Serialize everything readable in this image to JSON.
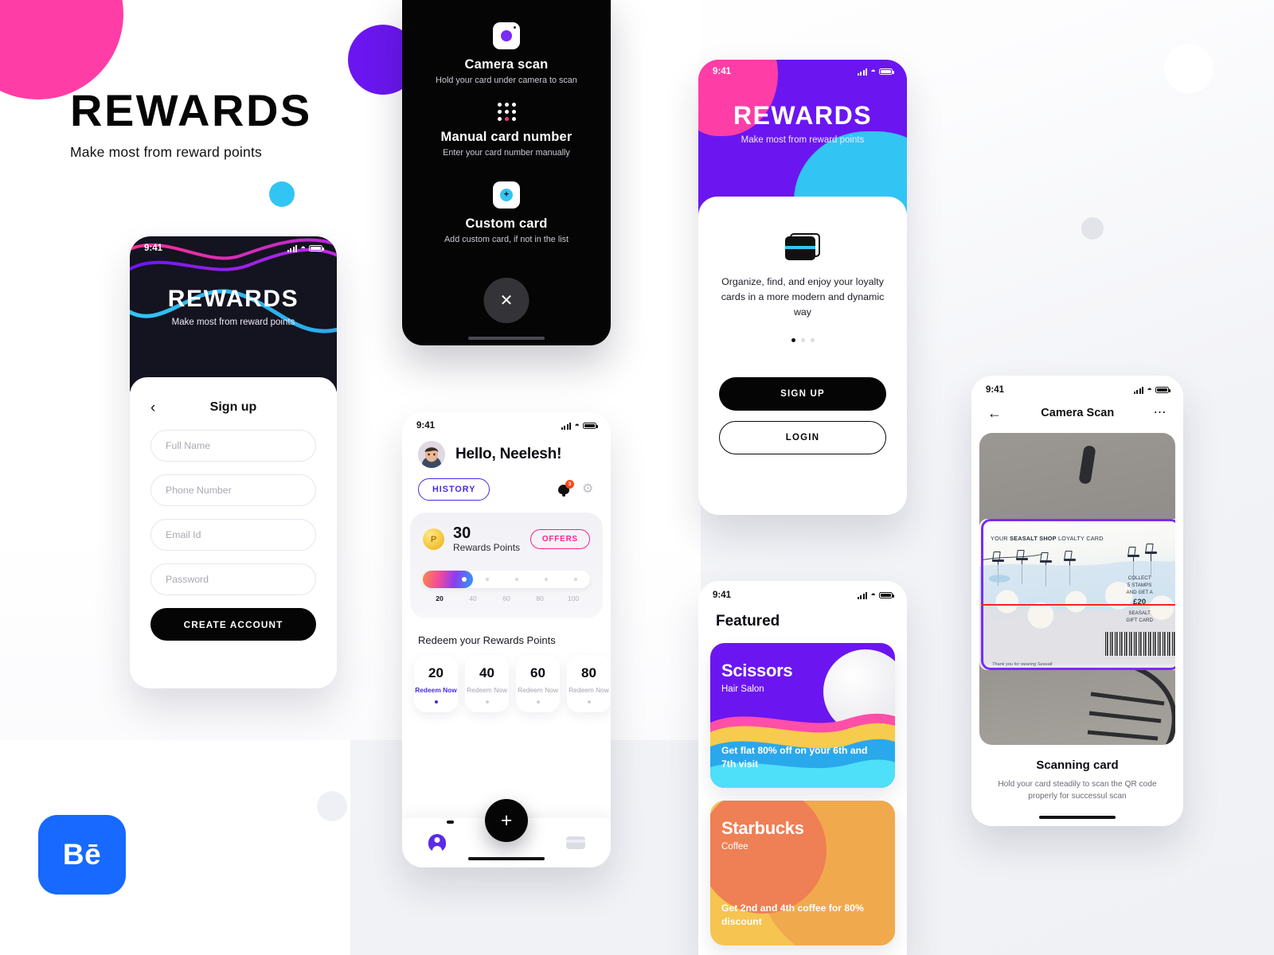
{
  "hero": {
    "title": "REWARDS",
    "subtitle": "Make most from reward points"
  },
  "behance": {
    "mark": "Bē"
  },
  "colors": {
    "background": "#F2F3F7",
    "pink": "#FF3DA6",
    "purple": "#6B16F0",
    "cyan": "#32C5F4",
    "indigo": "#4B2AE0",
    "magenta": "#FF1F8E",
    "black": "#050505",
    "behance_blue": "#1769FF",
    "orange": "#EF7F54",
    "yellow": "#F5C451",
    "laser_red": "#FF2020"
  },
  "status_bar": {
    "time": "9:41"
  },
  "signup_screen": {
    "hero_title": "REWARDS",
    "hero_subtitle": "Make most from reward points",
    "back_icon": "chevron-left-icon",
    "heading": "Sign up",
    "fields": [
      {
        "placeholder": "Full Name"
      },
      {
        "placeholder": "Phone Number"
      },
      {
        "placeholder": "Email Id"
      },
      {
        "placeholder": "Password"
      }
    ],
    "cta": "CREATE ACCOUNT"
  },
  "add_card_sheet": {
    "options": [
      {
        "icon": "camera-icon",
        "title": "Camera scan",
        "desc": "Hold your card under camera to scan"
      },
      {
        "icon": "keypad-icon",
        "title": "Manual card number",
        "desc": "Enter your card number manually"
      },
      {
        "icon": "plus-circle-icon",
        "title": "Custom card",
        "desc": "Add custom card, if not in the list"
      }
    ],
    "close_icon": "close-icon"
  },
  "dashboard": {
    "greeting": "Hello, Neelesh!",
    "avatar_icon": "avatar",
    "history_button": "HISTORY",
    "bell_icon": "bell-icon",
    "notification_count": "3",
    "gear_icon": "gear-icon",
    "points_value": "30",
    "points_label": "Rewards Points",
    "coin_letter": "P",
    "offers_button": "OFFERS",
    "progress_percent": 30,
    "scale_ticks": [
      "20",
      "40",
      "60",
      "80",
      "100"
    ],
    "active_tick_index": 0,
    "redeem_heading": "Redeem your Rewards Points",
    "redeem_cards": [
      {
        "amount": "20",
        "action": "Redeem Now",
        "active": true
      },
      {
        "amount": "40",
        "action": "Redeem Now",
        "active": false
      },
      {
        "amount": "60",
        "action": "Redeem Now",
        "active": false
      },
      {
        "amount": "80",
        "action": "Redeem Now",
        "active": false
      }
    ],
    "nav": {
      "profile_icon": "person-icon",
      "add_icon": "plus-icon",
      "cards_icon": "card-icon"
    }
  },
  "onboarding": {
    "hero_title": "REWARDS",
    "hero_subtitle": "Make most from reward points",
    "cards_icon": "stacked-cards-icon",
    "description": "Organize, find, and enjoy your loyalty cards in a more modern and dynamic way",
    "dots_total": 3,
    "dots_active": 1,
    "signup_button": "SIGN UP",
    "login_button": "LOGIN"
  },
  "featured": {
    "title": "Featured",
    "offers": [
      {
        "brand": "Scissors",
        "category": "Hair Salon",
        "promo": "Get flat 80% off on your 6th and 7th visit"
      },
      {
        "brand": "Starbucks",
        "category": "Coffee",
        "promo": "Get 2nd and 4th coffee for 80% discount"
      }
    ]
  },
  "camera_scan": {
    "back_icon": "arrow-left-icon",
    "nav_title": "Camera Scan",
    "more_icon": "more-horizontal-icon",
    "card": {
      "header_pre": "YOUR ",
      "header_bold": "SEASALT SHOP",
      "header_post": " LOYALTY CARD",
      "collect_line1": "COLLECT",
      "collect_line2": "5 STAMPS",
      "collect_line3": "AND GET A",
      "amount": "£20",
      "collect_line4": "SEASALT",
      "collect_line5": "GIFT CARD",
      "footer": "Thank you for wearing Seasalt"
    },
    "scan_title": "Scanning card",
    "scan_desc": "Hold your card steadily to scan the QR code properly for successul scan"
  }
}
